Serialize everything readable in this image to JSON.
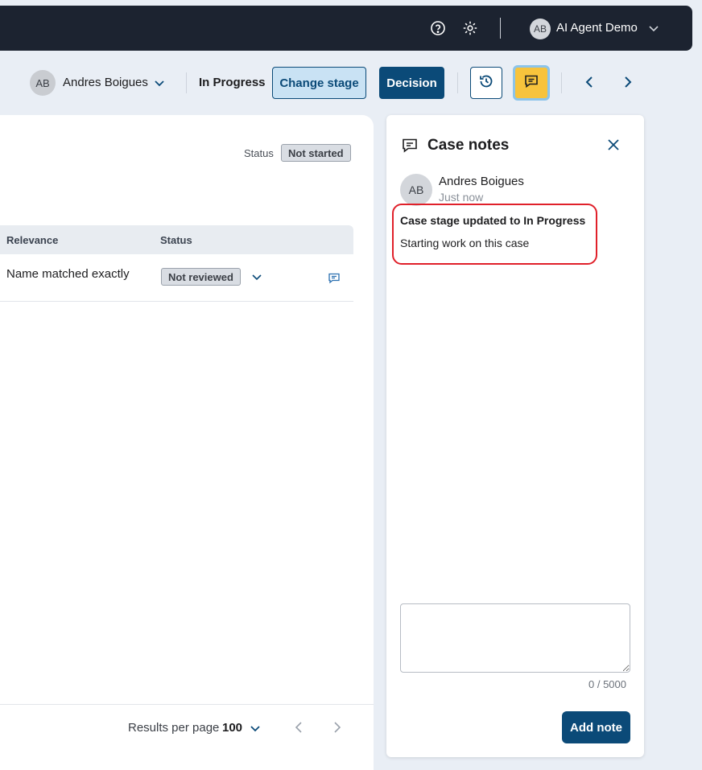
{
  "topbar": {
    "user_initials": "AB",
    "user_name": "AI Agent Demo",
    "icons": [
      "help-circle-icon",
      "gear-icon",
      "chevron-down-icon"
    ]
  },
  "case_header": {
    "assignee_initials": "AB",
    "assignee_name": "Andres Boigues",
    "stage": "In Progress",
    "change_stage_label": "Change stage",
    "decision_label": "Decision",
    "icons": [
      "history-icon",
      "comment-icon",
      "chevron-left-icon",
      "chevron-right-icon"
    ]
  },
  "main": {
    "status_label": "Status",
    "status_value": "Not started",
    "table": {
      "columns": [
        "Relevance",
        "Status"
      ],
      "rows": [
        {
          "relevance": "Name matched exactly",
          "status": "Not reviewed"
        }
      ]
    },
    "pagination": {
      "results_per_page_label": "Results per page",
      "results_per_page_value": "100"
    }
  },
  "notes": {
    "title": "Case notes",
    "entries": [
      {
        "author_initials": "AB",
        "author": "Andres Boigues",
        "time": "Just now",
        "heading": "Case stage updated to In Progress",
        "body": "Starting work on this case"
      }
    ],
    "char_count": "0 / 5000",
    "add_note_label": "Add note"
  },
  "colors": {
    "topbar_bg": "#1c2330",
    "primary": "#0b4a78",
    "highlight_border": "#e0202a",
    "notes_button": "#f7c33c"
  }
}
